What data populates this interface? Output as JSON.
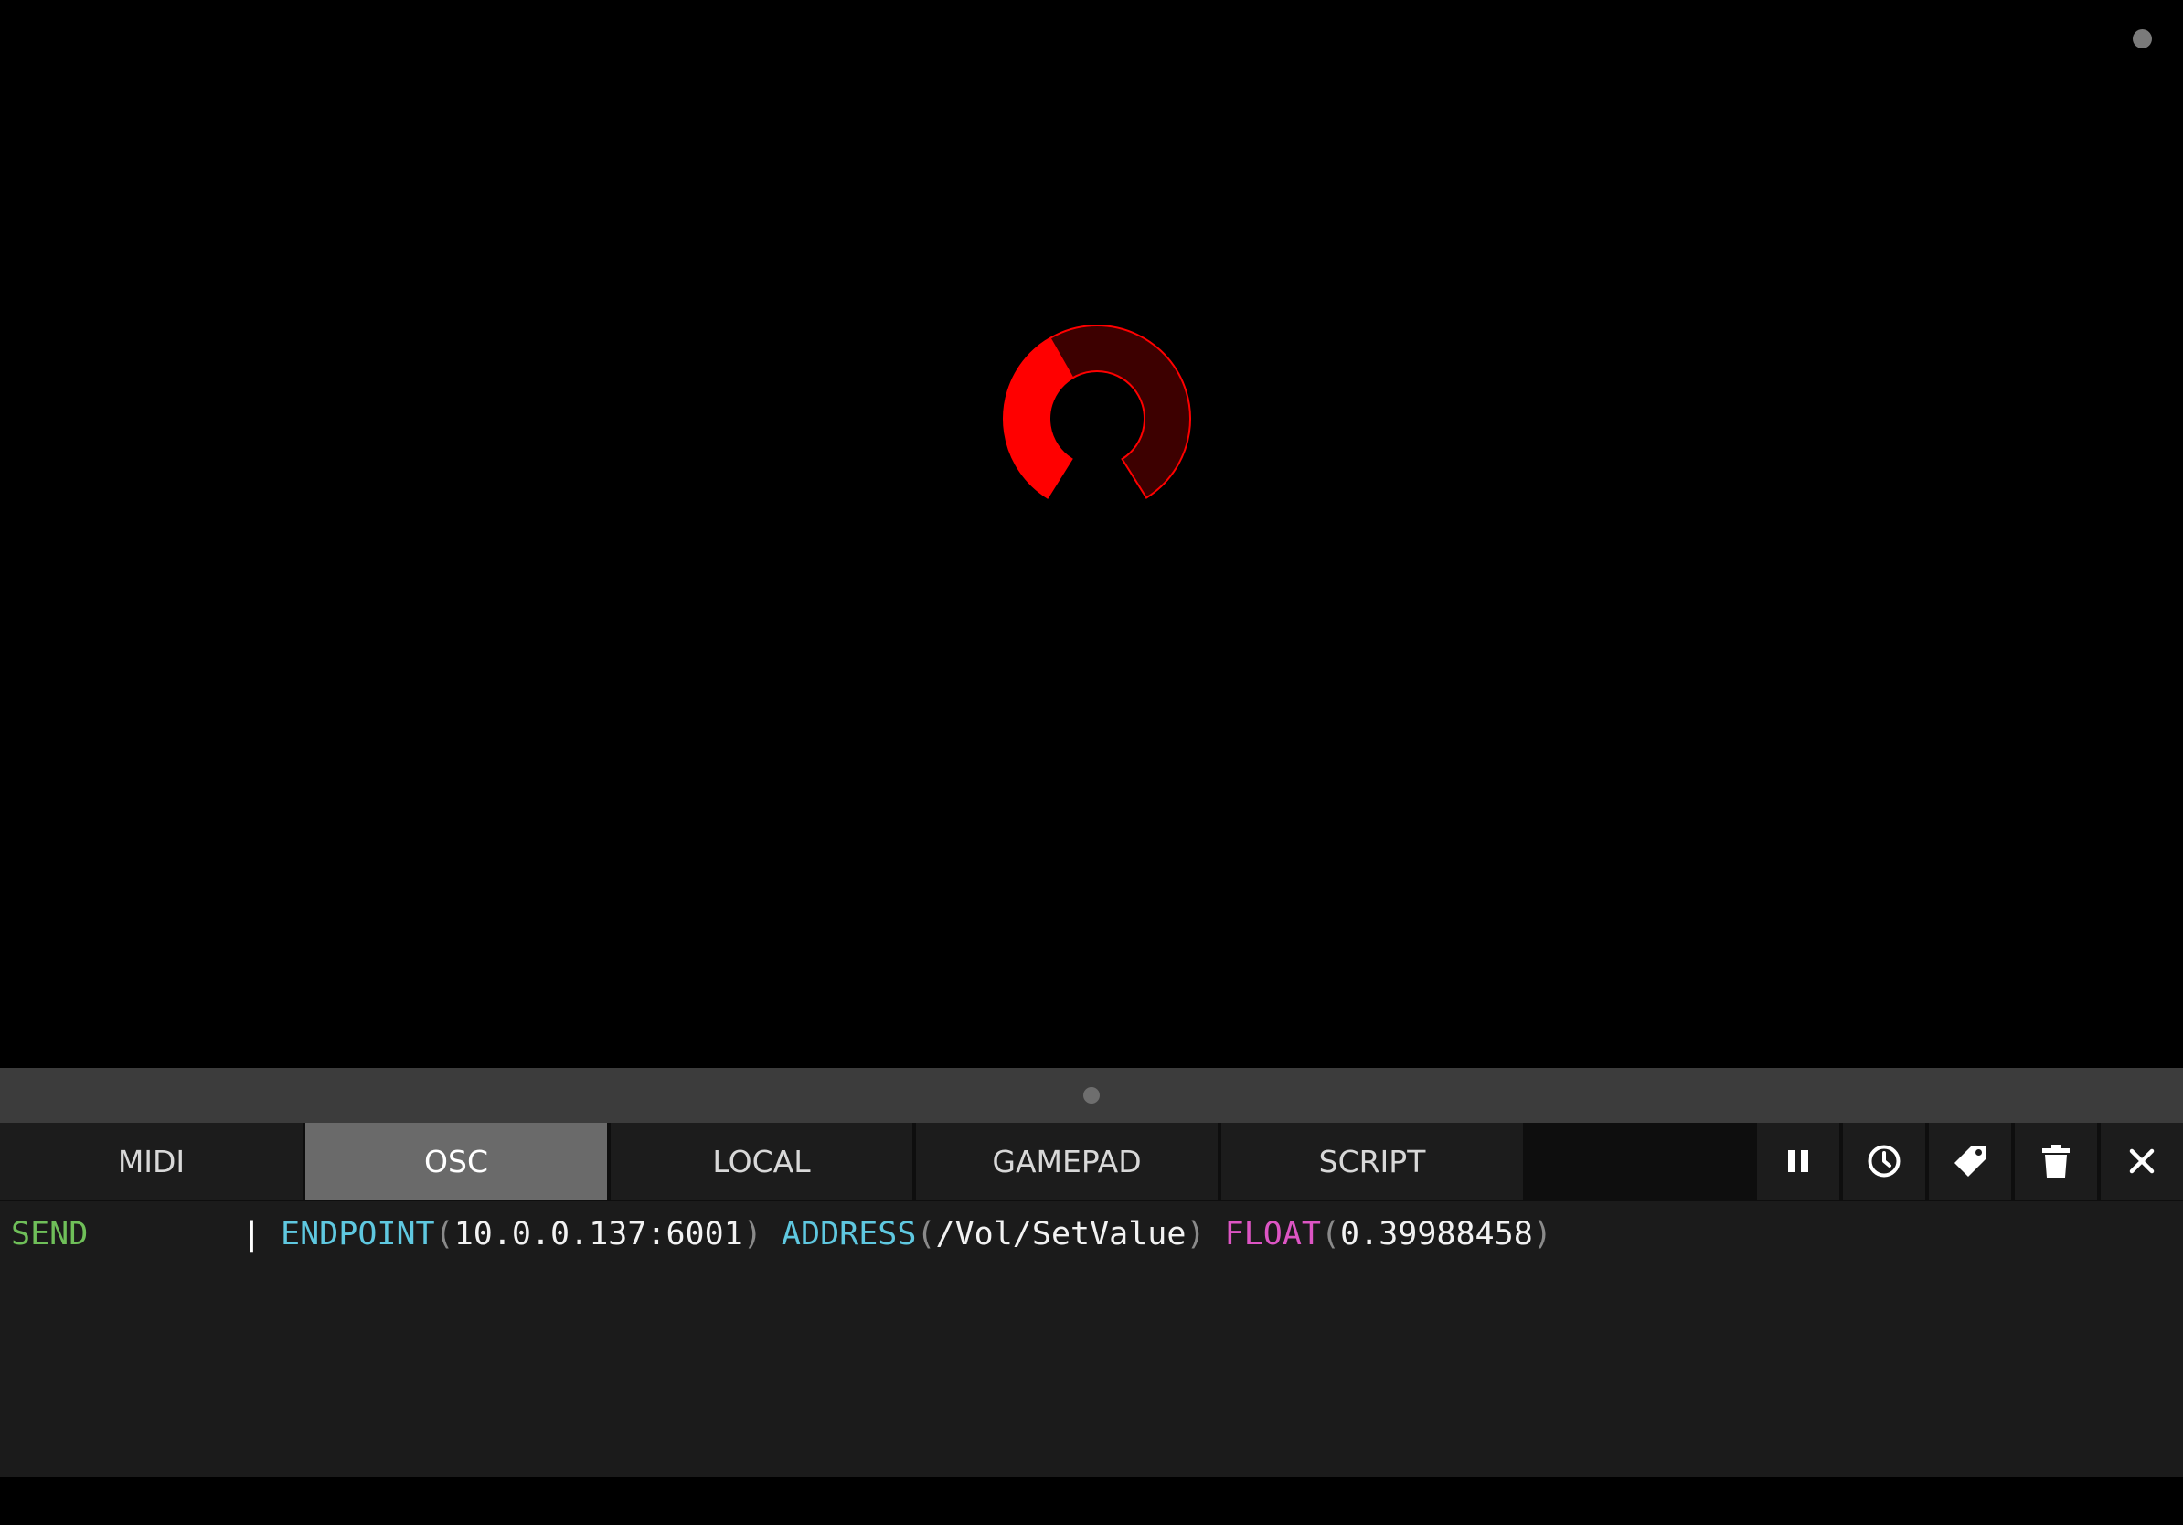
{
  "canvas": {
    "knob": {
      "value": 0.39988458,
      "active_color": "#ff0000",
      "inactive_color": "#3d0000",
      "outline_color": "#ff0000"
    },
    "status_indicator_color": "#7a7a7a"
  },
  "tabs": [
    {
      "label": "MIDI",
      "active": false
    },
    {
      "label": "OSC",
      "active": true
    },
    {
      "label": "LOCAL",
      "active": false
    },
    {
      "label": "GAMEPAD",
      "active": false
    },
    {
      "label": "SCRIPT",
      "active": false
    }
  ],
  "toolbar": {
    "icons": [
      "pause-icon",
      "clock-icon",
      "tag-icon",
      "trash-icon",
      "close-icon"
    ]
  },
  "log": {
    "entries": [
      {
        "direction": "SEND",
        "separator": "|",
        "endpoint_key": "ENDPOINT",
        "endpoint_value": "10.0.0.137:6001",
        "address_key": "ADDRESS",
        "address_value": "/Vol/SetValue",
        "type_key": "FLOAT",
        "type_value": "0.39988458"
      }
    ]
  },
  "colors": {
    "send": "#6fbf59",
    "key": "#5fc8e0",
    "float": "#dd55c4",
    "active_tab": "#6a6a6a"
  }
}
